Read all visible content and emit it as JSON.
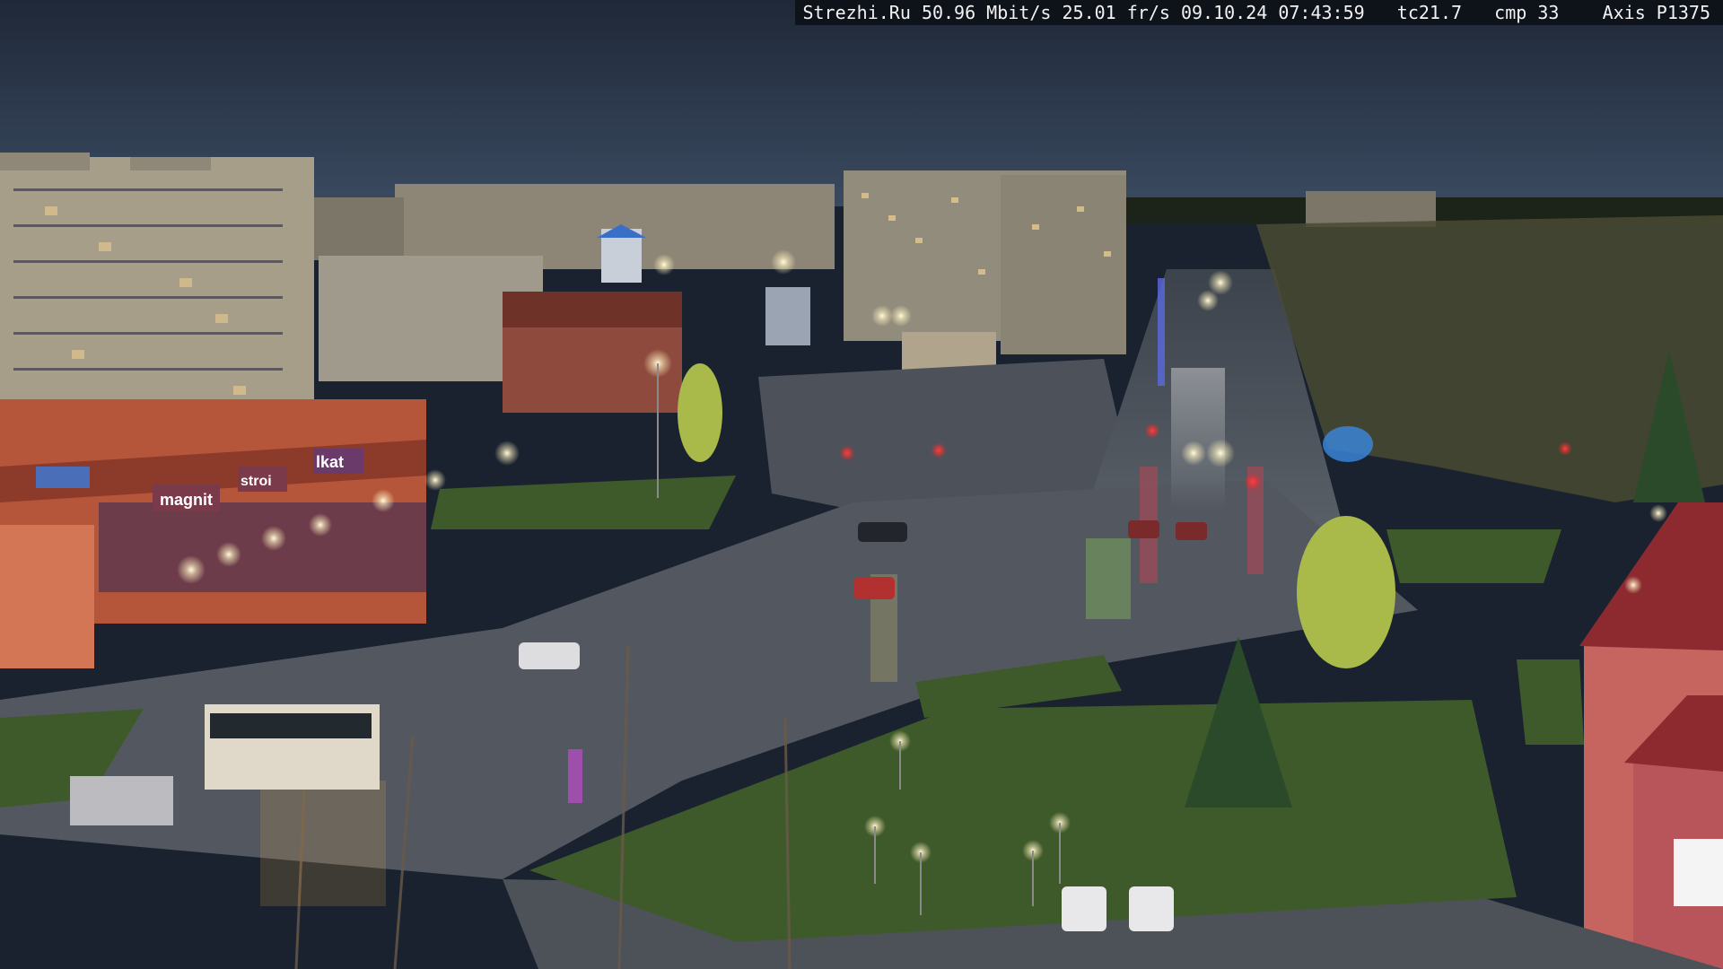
{
  "overlay": {
    "site": "Strezhi.Ru",
    "bitrate": "50.96 Mbit/s",
    "framerate": "25.01 fr/s",
    "date": "09.10.24",
    "time": "07:43:59",
    "tc": "tc21.7",
    "cmp": "cmp 33",
    "camera": "Axis P1375"
  },
  "signs": {
    "store_left": "magnit",
    "store_mid": "stroi",
    "store_right": "lkat"
  },
  "colors": {
    "sky_top": "#222c3d",
    "sky_bottom": "#394a63",
    "road": "#4a5058",
    "grass": "#3e5a2c",
    "building_brick": "#b5553a",
    "streetlight": "#fff6d8"
  }
}
